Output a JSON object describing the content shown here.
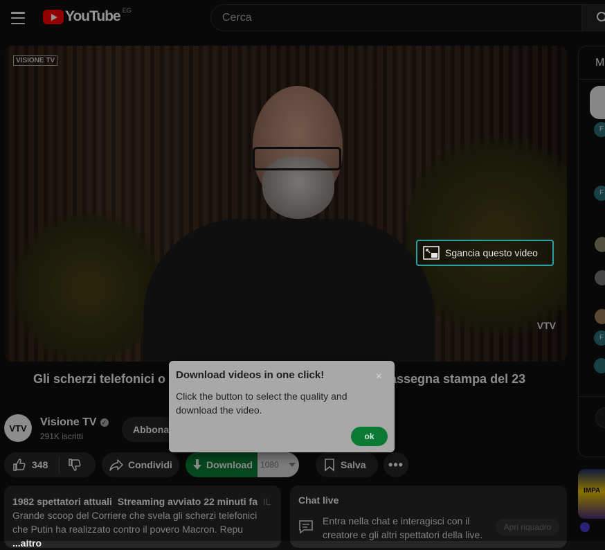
{
  "header": {
    "logo_text": "YouTube",
    "country_code": "EG",
    "search_placeholder": "Cerca"
  },
  "player": {
    "watermark_top": "VISIONE TV",
    "watermark_bottom": "VTV",
    "pip_label": "Sgancia questo video"
  },
  "video": {
    "title_start": "Gli scherzi telefonici o",
    "title_end": "assegna stampa del 23"
  },
  "channel": {
    "avatar_text": "VTV",
    "name": "Visione TV",
    "verified": "✓",
    "subscribers": "291K iscritti",
    "subscribe_label": "Abbona"
  },
  "actions": {
    "likes": "348",
    "share_label": "Condividi",
    "download_label": "Download",
    "download_quality": "1080",
    "save_label": "Salva",
    "more_label": "•••"
  },
  "description": {
    "viewers": "1982 spettatori attuali",
    "started": "Streaming avviato 22 minuti fa",
    "tag": "IL C",
    "line1": "Grande scoop del Corriere che svela gli scherzi telefonici",
    "line2": "che Putin ha realizzato contro il povero Macron. Repu",
    "more": "...altro"
  },
  "chat": {
    "title": "Chat live",
    "body": "Entra nella chat e interagisci con il creatore e gli altri spettatori della live.",
    "open_label": "Apri riquadro"
  },
  "side": {
    "header_initial": "M",
    "badge": "F",
    "thumb_text": "IMPA"
  },
  "tooltip": {
    "title": "Download videos in one click!",
    "body": "Click the button to select the quality and download the video.",
    "ok_label": "ok",
    "close_label": "×"
  }
}
